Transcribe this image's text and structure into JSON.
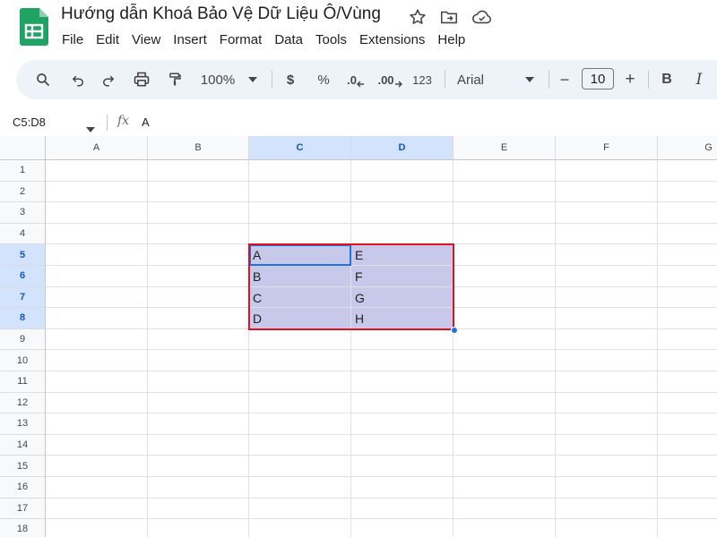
{
  "app": {
    "title": "Hướng dẫn Khoá Bảo Vệ Dữ Liệu Ô/Vùng",
    "brand_color": "#1ea362"
  },
  "menu": [
    "File",
    "Edit",
    "View",
    "Insert",
    "Format",
    "Data",
    "Tools",
    "Extensions",
    "Help"
  ],
  "toolbar": {
    "zoom": "100%",
    "currency": "$",
    "percent": "%",
    "decrease_decimal": ".0",
    "increase_decimal": ".00",
    "number_format": "123",
    "font": "Arial",
    "font_size": "10",
    "minus": "−",
    "plus": "+",
    "bold": "B",
    "italic": "I"
  },
  "formula_bar": {
    "name_box": "C5:D8",
    "fx": "fx",
    "value": "A"
  },
  "sheet": {
    "columns": [
      "A",
      "B",
      "C",
      "D",
      "E",
      "F",
      "G"
    ],
    "selected_columns": [
      "C",
      "D"
    ],
    "rows": [
      "1",
      "2",
      "3",
      "4",
      "5",
      "6",
      "7",
      "8",
      "9",
      "10",
      "11",
      "12",
      "13",
      "14",
      "15",
      "16",
      "17",
      "18"
    ],
    "selected_rows": [
      "5",
      "6",
      "7",
      "8"
    ],
    "cells": {
      "C5": "A",
      "D5": "E",
      "C6": "B",
      "D6": "F",
      "C7": "C",
      "D7": "G",
      "C8": "D",
      "D8": "H"
    },
    "selection_color": "#c7c8ea",
    "range_highlight_color": "#e0111d",
    "active_cell_color": "#1a73e8"
  }
}
